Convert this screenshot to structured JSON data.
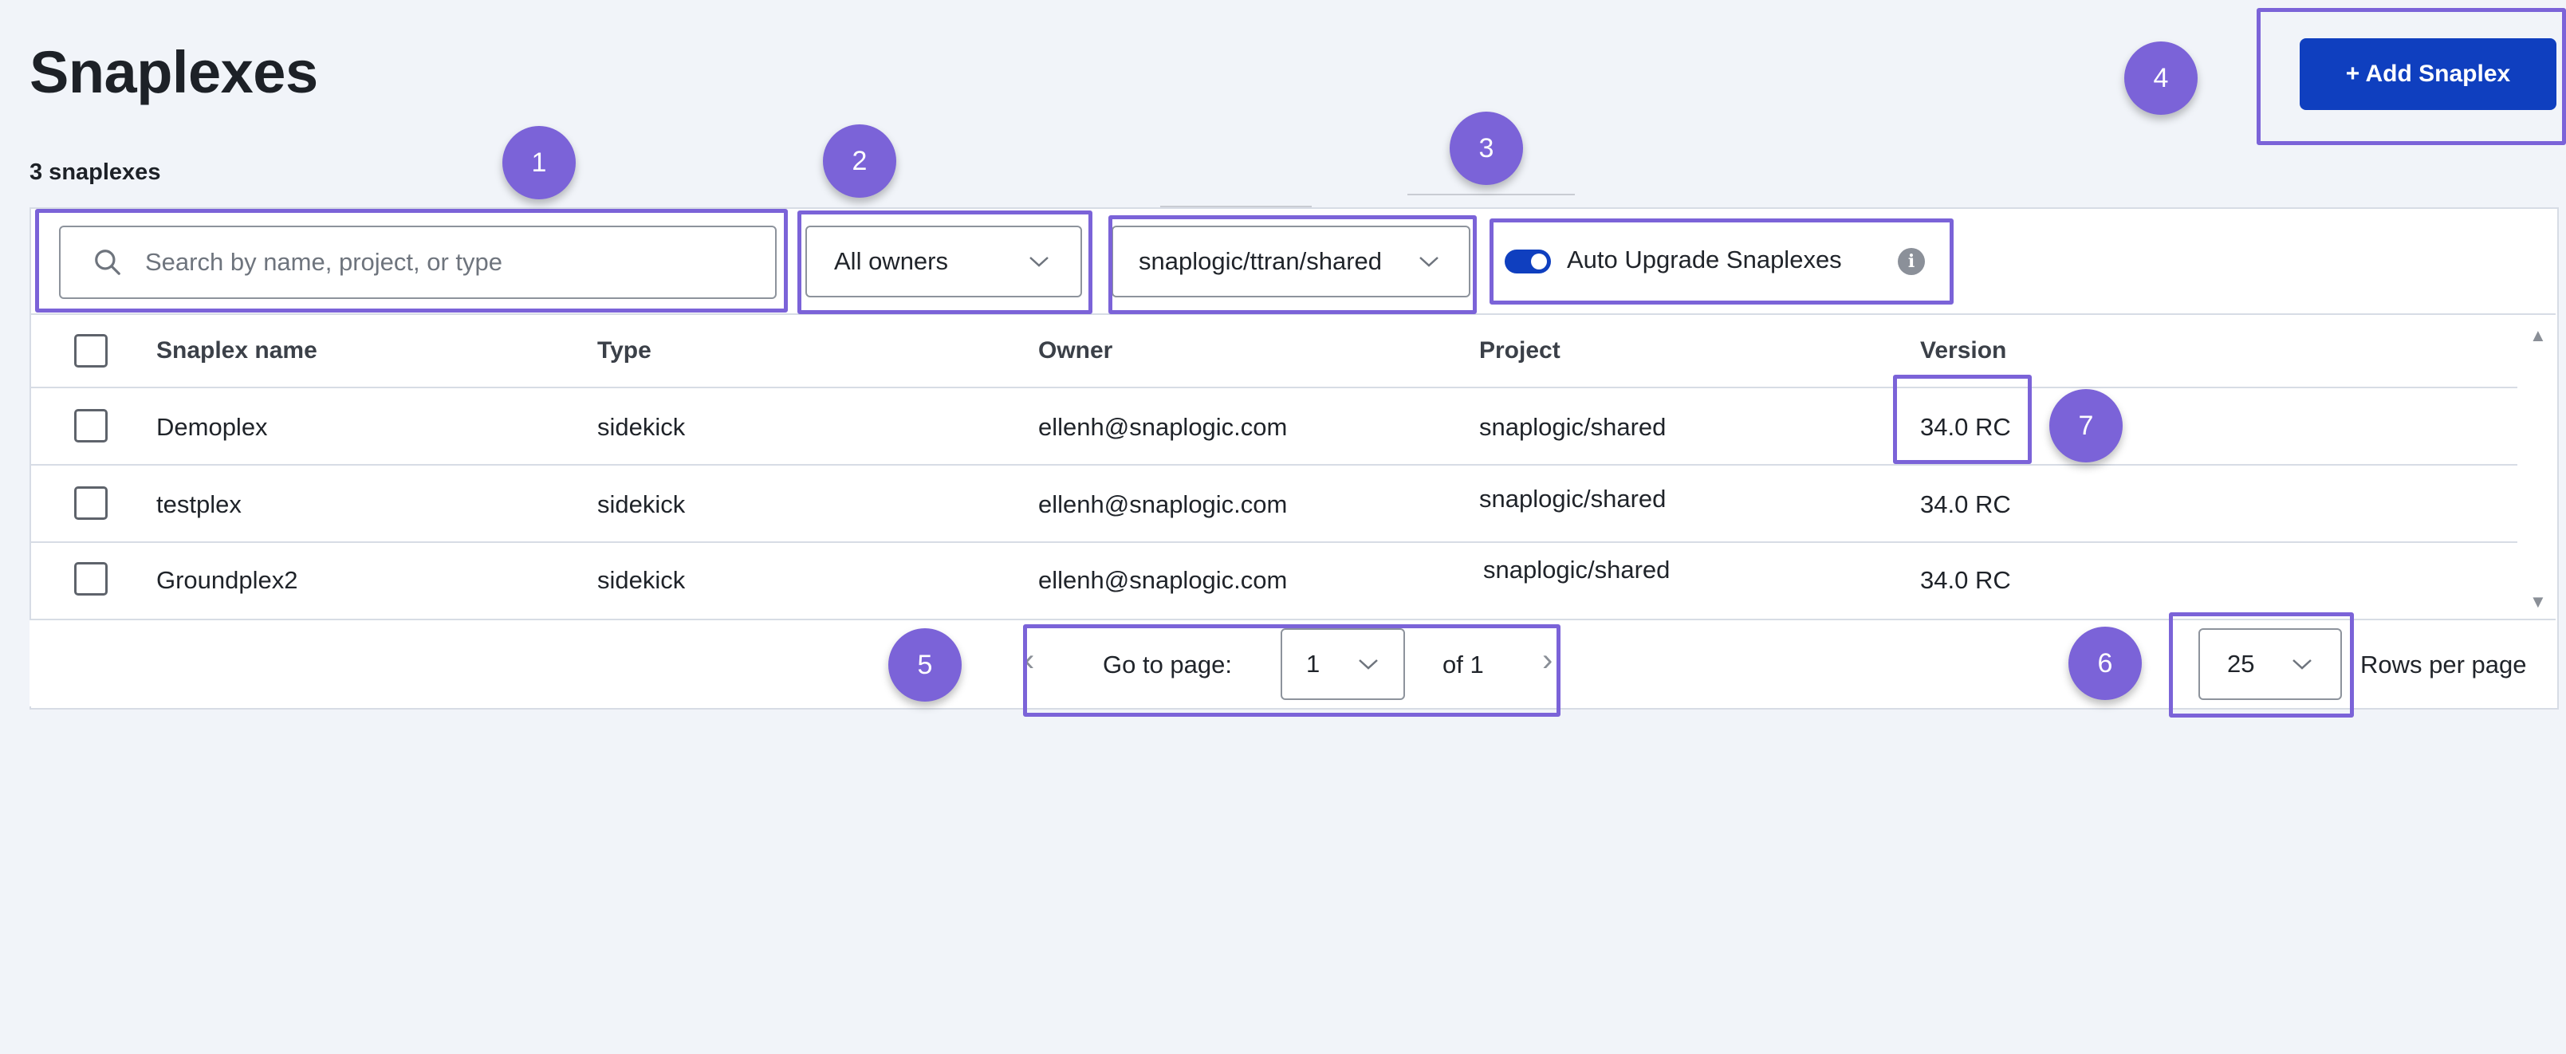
{
  "header": {
    "title": "Snaplexes",
    "count_label": "3 snaplexes",
    "add_button": "+ Add Snaplex"
  },
  "filters": {
    "search_placeholder": "Search by name, project, or type",
    "owner_select": "All owners",
    "project_select": "snaplogic/ttran/shared",
    "auto_upgrade_label": "Auto Upgrade Snaplexes",
    "auto_upgrade_on": true
  },
  "table": {
    "columns": [
      "Snaplex name",
      "Type",
      "Owner",
      "Project",
      "Version"
    ],
    "rows": [
      [
        "Demoplex",
        "sidekick",
        "ellenh@snaplogic.com",
        "snaplogic/shared",
        "34.0 RC"
      ],
      [
        "testplex",
        "sidekick",
        "ellenh@snaplogic.com",
        "snaplogic/shared",
        "34.0 RC"
      ],
      [
        "Groundplex2",
        "sidekick",
        "ellenh@snaplogic.com",
        "snaplogic/shared",
        "34.0 RC"
      ]
    ]
  },
  "pagination": {
    "goto_label": "Go to page:",
    "page_value": "1",
    "of_label": "of 1",
    "rows_value": "25",
    "rows_label": "Rows per page"
  },
  "annotations": [
    "1",
    "2",
    "3",
    "4",
    "5",
    "6",
    "7"
  ],
  "colors": {
    "accent": "#0f3fbf",
    "annotation": "#7b63d8"
  }
}
